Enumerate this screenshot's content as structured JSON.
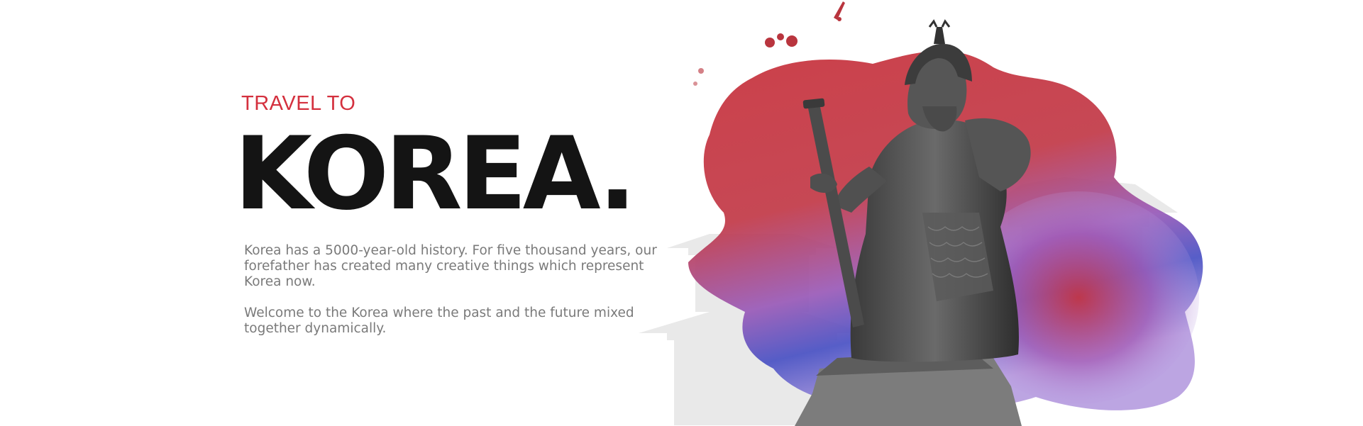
{
  "hero": {
    "eyebrow": "TRAVEL TO",
    "headline": "KOREA.",
    "paragraphs": [
      "Korea has a 5000-year-old history. For five thousand years, our forefather has created many creative things which represent Korea now.",
      "Welcome to the Korea where the past and the future mixed together dynamically."
    ]
  },
  "colors": {
    "accent": "#d4303e",
    "headline": "#141414",
    "body": "#7a7a7a",
    "splash_red": "#c8323c",
    "splash_blue": "#3d4fc0",
    "splash_purple": "#8f6cc8",
    "statue": "#4a4a4a"
  },
  "art": {
    "subject": "admiral-statue-with-sword",
    "background": "traditional-korean-palace-silhouette",
    "effect": "red-blue-watercolor-splash"
  }
}
